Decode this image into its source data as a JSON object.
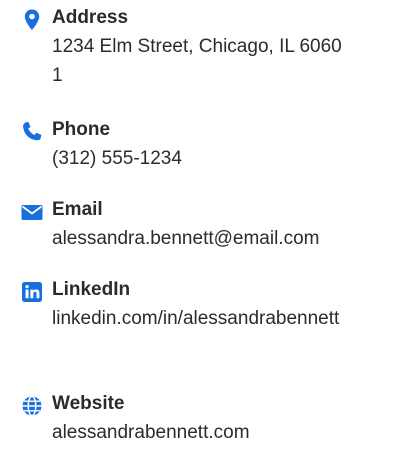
{
  "contacts": [
    {
      "icon": "map-pin-icon",
      "label": "Address",
      "value": "1234 Elm Street, Chicago, IL 60601"
    },
    {
      "icon": "phone-icon",
      "label": "Phone",
      "value": "(312) 555-1234"
    },
    {
      "icon": "envelope-icon",
      "label": "Email",
      "value": "alessandra.bennett@email.com"
    },
    {
      "icon": "linkedin-icon",
      "label": "LinkedIn",
      "value": "linkedin.com/in/alessandrabennett"
    },
    {
      "icon": "globe-icon",
      "label": "Website",
      "value": "alessandrabennett.com"
    }
  ],
  "colors": {
    "accent": "#1a6fe0",
    "text": "#2b2b2b"
  }
}
